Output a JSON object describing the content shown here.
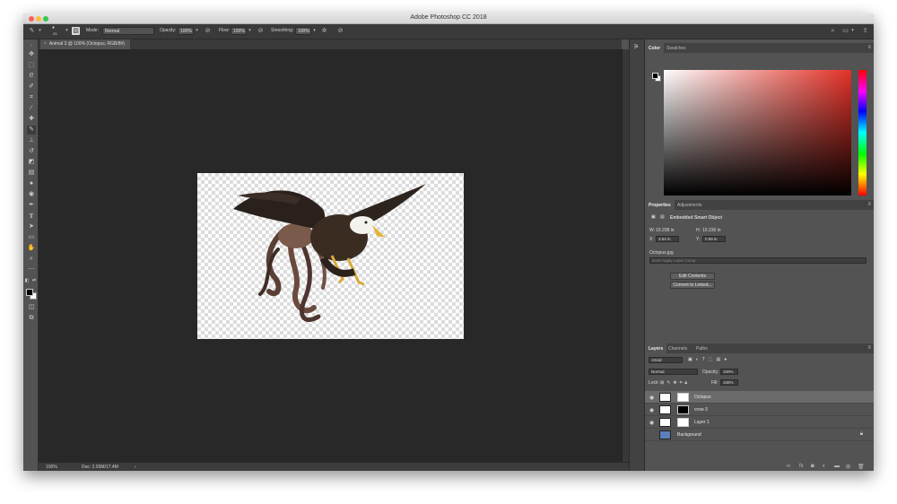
{
  "app": {
    "window_title": "Adobe Photoshop CC 2018"
  },
  "options_bar": {
    "brush_size": "25",
    "mode_label": "Mode:",
    "mode_value": "Normal",
    "opacity_label": "Opacity:",
    "opacity_value": "100%",
    "flow_label": "Flow:",
    "flow_value": "100%",
    "smoothing_label": "Smoothing:",
    "smoothing_value": "100%"
  },
  "document": {
    "tab_title": "Animal 3 @ 100% (Octopus, RGB/8#)",
    "image_description_icons": [
      "eagle",
      "octopus"
    ]
  },
  "status_bar": {
    "zoom": "100%",
    "doc_size": "Doc: 2.93M/17.4M"
  },
  "color_panel": {
    "tabs": [
      "Color",
      "Swatches"
    ],
    "colors": {
      "hue_red": "#e33127",
      "foreground": "#000000",
      "background": "#ffffff"
    }
  },
  "properties_panel": {
    "tabs": [
      "Properties",
      "Adjustments"
    ],
    "object_type": "Embedded Smart Object",
    "w_label": "W:",
    "w_value": "10.208 in",
    "h_label": "H:",
    "h_value": "10.236 in",
    "x_label": "X:",
    "x_value": "3.54 in",
    "y_label": "Y:",
    "y_value": "0.89 in",
    "filename": "Octopus.jpg",
    "layer_comp_placeholder": "Don't Apply Layer Comp",
    "edit_contents_label": "Edit Contents",
    "convert_label": "Convert to Linked..."
  },
  "layers_panel": {
    "tabs": [
      "Layers",
      "Channels",
      "Paths"
    ],
    "kind_label": "Kind",
    "blend_mode": "Normal",
    "opacity_label": "Opacity:",
    "opacity_value": "100%",
    "lock_label": "Lock:",
    "fill_label": "Fill:",
    "fill_value": "100%",
    "layers": [
      {
        "name": "Octopus"
      },
      {
        "name": "crow 3"
      },
      {
        "name": "Layer 1"
      },
      {
        "name": "Background"
      }
    ]
  }
}
